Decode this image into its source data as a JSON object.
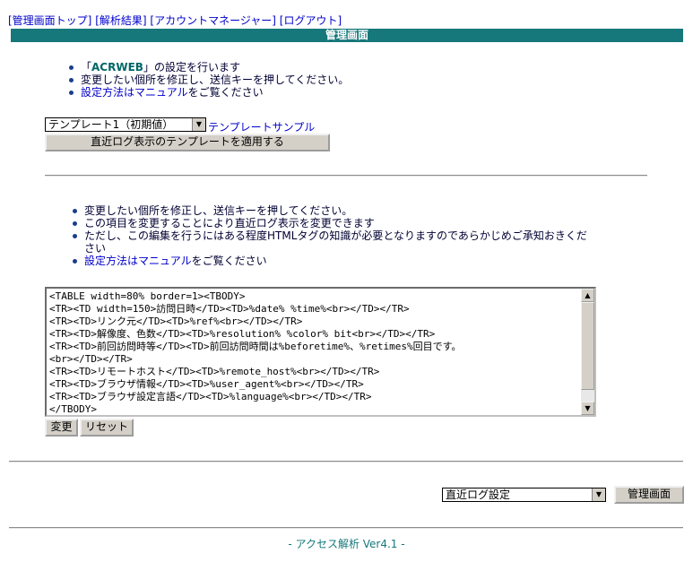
{
  "nav": {
    "links": [
      "[管理画面トップ]",
      "[解析結果]",
      "[アカウントマネージャー]",
      "[ログアウト]"
    ]
  },
  "header": {
    "title": "管理画面"
  },
  "intro": {
    "item1_prefix": "「",
    "item1_brand": "ACRWEB",
    "item1_suffix": "」の設定を行います",
    "item2": "変更したい個所を修正し、送信キーを押してください。",
    "item3_link": "設定方法はマニュアル",
    "item3_suffix": "をご覧ください"
  },
  "template": {
    "selected": "テンプレート1（初期値）",
    "sample_link": "テンプレートサンプル",
    "apply_button": "直近ログ表示のテンプレートを適用する"
  },
  "notes": {
    "item1": "変更したい個所を修正し、送信キーを押してください。",
    "item2": "この項目を変更することにより直近ログ表示を変更できます",
    "item3_line1": "ただし、この編集を行うにはある程度HTMLタグの知識が必要となりますのであらかじめご承知おきくだ",
    "item3_line2": "さい",
    "item4_link": "設定方法はマニュアル",
    "item4_suffix": "をご覧ください"
  },
  "editor": {
    "content": "<TABLE width=80% border=1><TBODY>\n<TR><TD width=150>訪問日時</TD><TD>%date% %time%<br></TD></TR>\n<TR><TD>リンク元</TD><TD>%ref%<br></TD></TR>\n<TR><TD>解像度、色数</TD><TD>%resolution% %color% bit<br></TD></TR>\n<TR><TD>前回訪問時等</TD><TD>前回訪問時間は%beforetime%、%retimes%回目です。\n<br></TD></TR>\n<TR><TD>リモートホスト</TD><TD>%remote_host%<br></TD></TR>\n<TR><TD>ブラウザ情報</TD><TD>%user_agent%<br></TD></TR>\n<TR><TD>ブラウザ設定言語</TD><TD>%language%<br></TD></TR>\n</TBODY>"
  },
  "actions": {
    "change": "変更",
    "reset": "リセット"
  },
  "bottom": {
    "selected": "直近ログ設定",
    "admin_button": "管理画面"
  },
  "footer": {
    "text": "- アクセス解析 Ver4.1 -"
  },
  "colors": {
    "header_bg": "#16787a",
    "link": "#0000cc"
  }
}
